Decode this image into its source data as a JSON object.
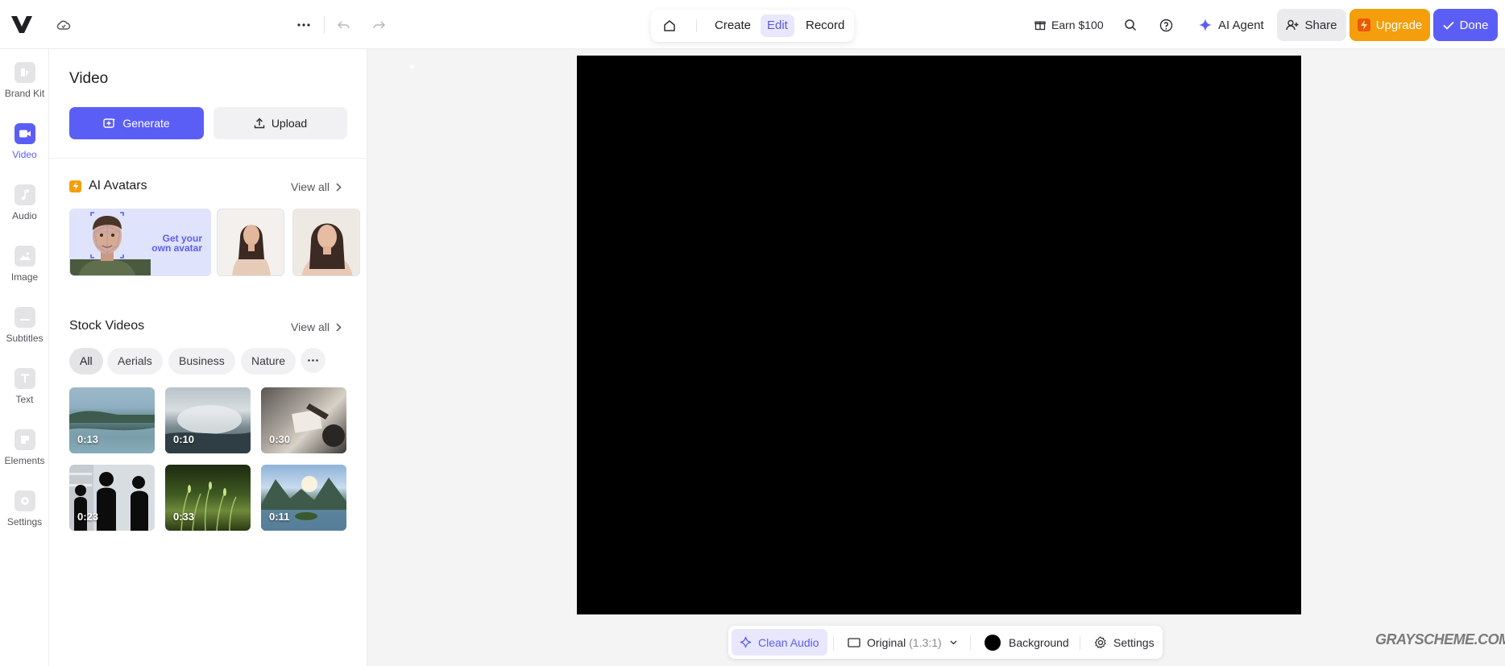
{
  "topbar": {
    "modes": {
      "create": "Create",
      "edit": "Edit",
      "record": "Record"
    },
    "earn": "Earn $100",
    "ai_agent": "AI Agent",
    "share": "Share",
    "upgrade": "Upgrade",
    "done": "Done"
  },
  "rail": {
    "items": [
      {
        "label": "Brand Kit"
      },
      {
        "label": "Video"
      },
      {
        "label": "Audio"
      },
      {
        "label": "Image"
      },
      {
        "label": "Subtitles"
      },
      {
        "label": "Text"
      },
      {
        "label": "Elements"
      },
      {
        "label": "Settings"
      }
    ]
  },
  "panel": {
    "title": "Video",
    "generate": "Generate",
    "upload": "Upload",
    "avatars": {
      "title": "AI Avatars",
      "view_all": "View all",
      "get_avatar": "Get your own avatar"
    },
    "stock": {
      "title": "Stock Videos",
      "view_all": "View all",
      "chips": [
        "All",
        "Aerials",
        "Business",
        "Nature"
      ],
      "thumbs": [
        {
          "duration": "0:13"
        },
        {
          "duration": "0:10"
        },
        {
          "duration": "0:30"
        },
        {
          "duration": "0:23"
        },
        {
          "duration": "0:33"
        },
        {
          "duration": "0:11"
        }
      ]
    }
  },
  "bottombar": {
    "clean_audio": "Clean Audio",
    "original": "Original",
    "ratio": "(1.3:1)",
    "background": "Background",
    "settings": "Settings"
  },
  "watermark": "GRAYSCHEME.COM",
  "colors": {
    "accent": "#5b5ef5",
    "upgrade": "#f59e0b",
    "active_bg": "#e8e7fd"
  }
}
